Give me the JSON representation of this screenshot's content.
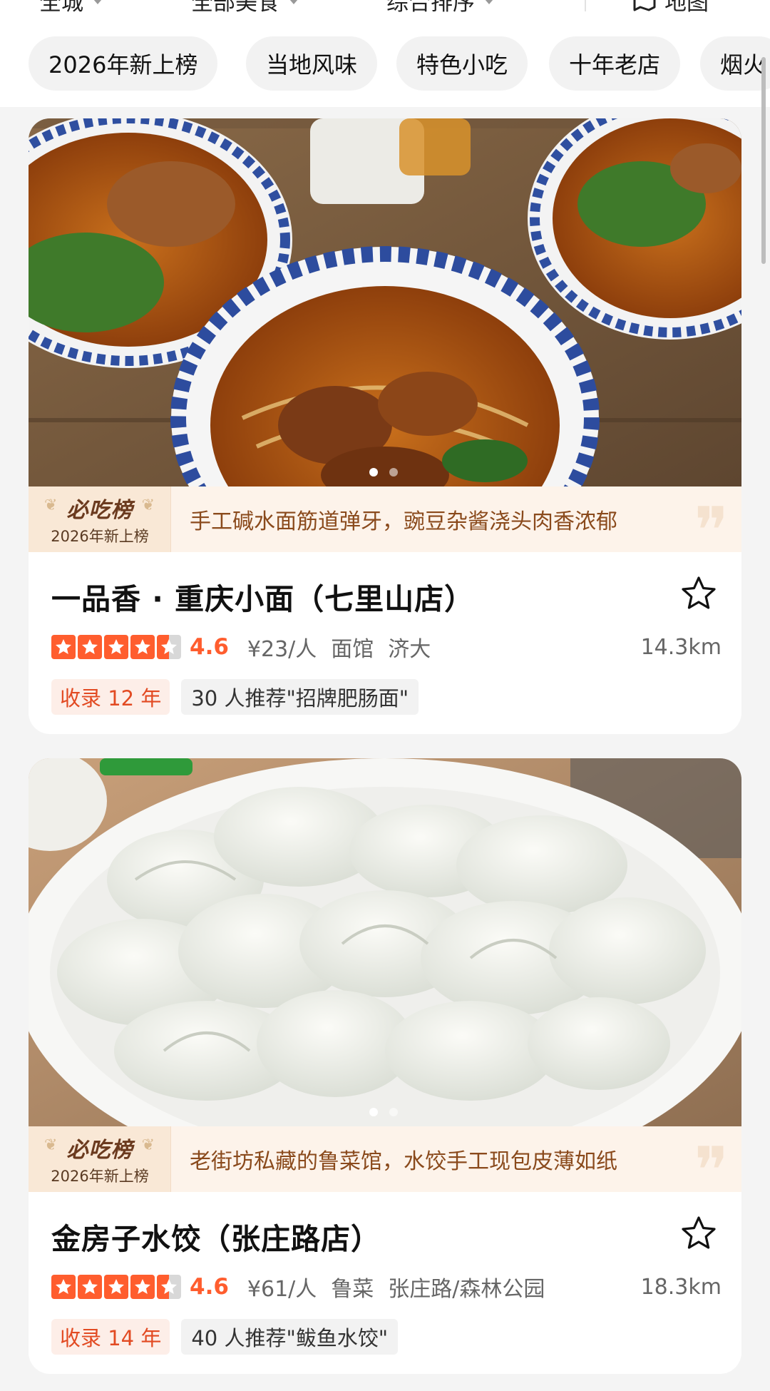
{
  "filters": [
    {
      "label": "全城"
    },
    {
      "label": "全部美食"
    },
    {
      "label": "综合排序"
    }
  ],
  "map_label": "地图",
  "chips": [
    {
      "label": "2026年新上榜"
    },
    {
      "label": "当地风味"
    },
    {
      "label": "特色小吃"
    },
    {
      "label": "十年老店"
    },
    {
      "label": "烟火"
    }
  ],
  "colors": {
    "accent": "#ff5d2e",
    "banner_bg": "#fdf3ea",
    "banner_text": "#8a4a1c"
  },
  "restaurants": [
    {
      "badge_logo": "必吃榜",
      "badge_sub": "2026年新上榜",
      "highlight": "手工碱水面筋道弹牙，豌豆杂酱浇头肉香浓郁",
      "name": "一品香 · 重庆小面（七里山店）",
      "rating": 4.6,
      "rating_text": "4.6",
      "price": "¥23/人",
      "category": "面馆",
      "area": "济大",
      "distance": "14.3km",
      "years_tag": "收录 12 年",
      "recommend_tag": "30 人推荐\"招牌肥肠面\"",
      "photo_subject": "noodle-bowls",
      "photo_count": 2,
      "photo_active": 0
    },
    {
      "badge_logo": "必吃榜",
      "badge_sub": "2026年新上榜",
      "highlight": "老街坊私藏的鲁菜馆，水饺手工现包皮薄如纸",
      "name": "金房子水饺（张庄路店）",
      "rating": 4.6,
      "rating_text": "4.6",
      "price": "¥61/人",
      "category": "鲁菜",
      "area": "张庄路/森林公园",
      "distance": "18.3km",
      "years_tag": "收录 14 年",
      "recommend_tag": "40 人推荐\"鲅鱼水饺\"",
      "photo_subject": "dumpling-plate",
      "photo_count": 2,
      "photo_active": 0
    }
  ]
}
